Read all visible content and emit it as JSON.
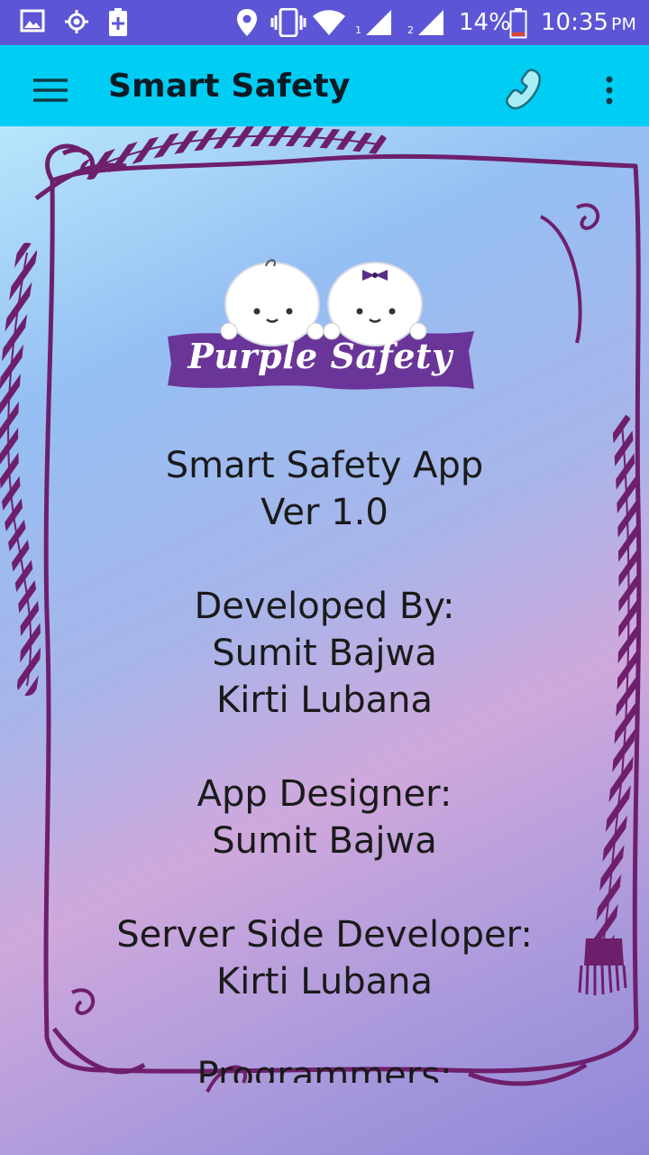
{
  "status_bar": {
    "battery_percent": "14%",
    "time": "10:35",
    "ampm": "PM",
    "icons": [
      "image-icon",
      "gps-icon",
      "battery-saver-icon",
      "location-icon",
      "vibrate-icon",
      "wifi-icon",
      "signal-sim1-icon",
      "signal-sim2-icon",
      "battery-icon"
    ],
    "sim1": "1",
    "sim2": "2",
    "bg_color": "#5c56d6"
  },
  "app_bar": {
    "title": "Smart Safety",
    "bg_color": "#00cdf4",
    "icons": [
      "menu-icon",
      "phone-icon",
      "overflow-menu-icon"
    ]
  },
  "logo": {
    "text": "Purple Safety",
    "banner_color": "#6a3598"
  },
  "about": {
    "app_name": "Smart Safety App",
    "version": "Ver 1.0",
    "developed_by_label": "Developed By:",
    "developer_1": "Sumit Bajwa",
    "developer_2": "Kirti Lubana",
    "designer_label": "App Designer:",
    "designer": "Sumit Bajwa",
    "server_label": "Server Side Developer:",
    "server_dev": "Kirti Lubana",
    "programmers_label": "Programmers:"
  },
  "frame_color": "#6e1f6c"
}
